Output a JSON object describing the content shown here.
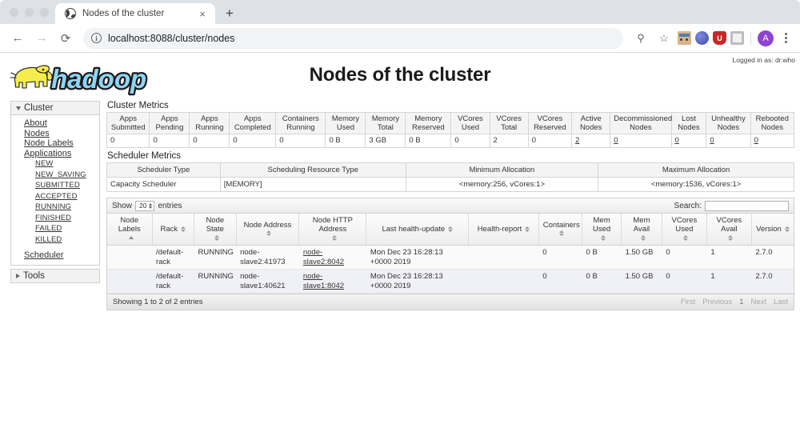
{
  "browser": {
    "tab_title": "Nodes of the cluster",
    "favicon_name": "globe-icon",
    "close_label": "×",
    "new_tab_label": "+",
    "back_label": "←",
    "forward_label": "→",
    "reload_label": "⟳",
    "url": "localhost:8088/cluster/nodes",
    "info_label": "i",
    "search_icon_label": "⚲",
    "star_label": "☆",
    "shield_label": "U",
    "avatar_label": "A"
  },
  "page": {
    "logged_in_as": "Logged in as: dr.who",
    "title": "Nodes of the cluster",
    "logo_alt": "hadoop"
  },
  "sidebar": {
    "cluster_header": "Cluster",
    "tools_header": "Tools",
    "items": [
      {
        "label": "About",
        "level": 1
      },
      {
        "label": "Nodes",
        "level": 1
      },
      {
        "label": "Node Labels",
        "level": 1
      },
      {
        "label": "Applications",
        "level": 1
      },
      {
        "label": "NEW",
        "level": 2
      },
      {
        "label": "NEW_SAVING",
        "level": 2
      },
      {
        "label": "SUBMITTED",
        "level": 2
      },
      {
        "label": "ACCEPTED",
        "level": 2
      },
      {
        "label": "RUNNING",
        "level": 2
      },
      {
        "label": "FINISHED",
        "level": 2
      },
      {
        "label": "FAILED",
        "level": 2
      },
      {
        "label": "KILLED",
        "level": 2
      },
      {
        "label": "Scheduler",
        "level": 1
      }
    ]
  },
  "cluster_metrics": {
    "section_title": "Cluster Metrics",
    "headers": [
      "Apps Submitted",
      "Apps Pending",
      "Apps Running",
      "Apps Completed",
      "Containers Running",
      "Memory Used",
      "Memory Total",
      "Memory Reserved",
      "VCores Used",
      "VCores Total",
      "VCores Reserved",
      "Active Nodes",
      "Decommissioned Nodes",
      "Lost Nodes",
      "Unhealthy Nodes",
      "Rebooted Nodes"
    ],
    "values": [
      "0",
      "0",
      "0",
      "0",
      "0",
      "0 B",
      "3 GB",
      "0 B",
      "0",
      "2",
      "0",
      "2",
      "0",
      "0",
      "0",
      "0"
    ],
    "link_flags": [
      false,
      false,
      false,
      false,
      false,
      false,
      false,
      false,
      false,
      false,
      false,
      true,
      true,
      true,
      true,
      true
    ]
  },
  "scheduler_metrics": {
    "section_title": "Scheduler Metrics",
    "headers": [
      "Scheduler Type",
      "Scheduling Resource Type",
      "Minimum Allocation",
      "Maximum Allocation"
    ],
    "row": [
      "Capacity Scheduler",
      "[MEMORY]",
      "<memory:256, vCores:1>",
      "<memory:1536, vCores:1>"
    ]
  },
  "nodes_table": {
    "show_label": "Show",
    "entries_value": "20",
    "entries_label": "entries",
    "search_label": "Search:",
    "search_value": "",
    "search_placeholder": "",
    "headers": [
      {
        "label": "Node Labels",
        "sort": "asc"
      },
      {
        "label": "Rack",
        "sort": "both"
      },
      {
        "label": "Node State",
        "sort": "both"
      },
      {
        "label": "Node Address",
        "sort": "both"
      },
      {
        "label": "Node HTTP Address",
        "sort": "both"
      },
      {
        "label": "Last health-update",
        "sort": "both"
      },
      {
        "label": "Health-report",
        "sort": "both"
      },
      {
        "label": "Containers",
        "sort": "both"
      },
      {
        "label": "Mem Used",
        "sort": "both"
      },
      {
        "label": "Mem Avail",
        "sort": "both"
      },
      {
        "label": "VCores Used",
        "sort": "both"
      },
      {
        "label": "VCores Avail",
        "sort": "both"
      },
      {
        "label": "Version",
        "sort": "both"
      }
    ],
    "rows": [
      {
        "node_labels": "",
        "rack": "/default-rack",
        "node_state": "RUNNING",
        "node_address": "node-slave2:41973",
        "node_http_address": "node-slave2:8042",
        "last_health_update": "Mon Dec 23 16:28:13 +0000 2019",
        "health_report": "",
        "containers": "0",
        "mem_used": "0 B",
        "mem_avail": "1.50 GB",
        "vcores_used": "0",
        "vcores_avail": "1",
        "version": "2.7.0"
      },
      {
        "node_labels": "",
        "rack": "/default-rack",
        "node_state": "RUNNING",
        "node_address": "node-slave1:40621",
        "node_http_address": "node-slave1:8042",
        "last_health_update": "Mon Dec 23 16:28:13 +0000 2019",
        "health_report": "",
        "containers": "0",
        "mem_used": "0 B",
        "mem_avail": "1.50 GB",
        "vcores_used": "0",
        "vcores_avail": "1",
        "version": "2.7.0"
      }
    ],
    "footer_info": "Showing 1 to 2 of 2 entries",
    "pagination": [
      "First",
      "Previous",
      "1",
      "Next",
      "Last"
    ]
  },
  "colors": {
    "accent": "#8e44d0",
    "chrome_tabstrip": "#dee1e6",
    "row_even": "#f0f0f7",
    "logo_blue": "#8fd5f5",
    "logo_yellow": "#f5ec4e"
  }
}
